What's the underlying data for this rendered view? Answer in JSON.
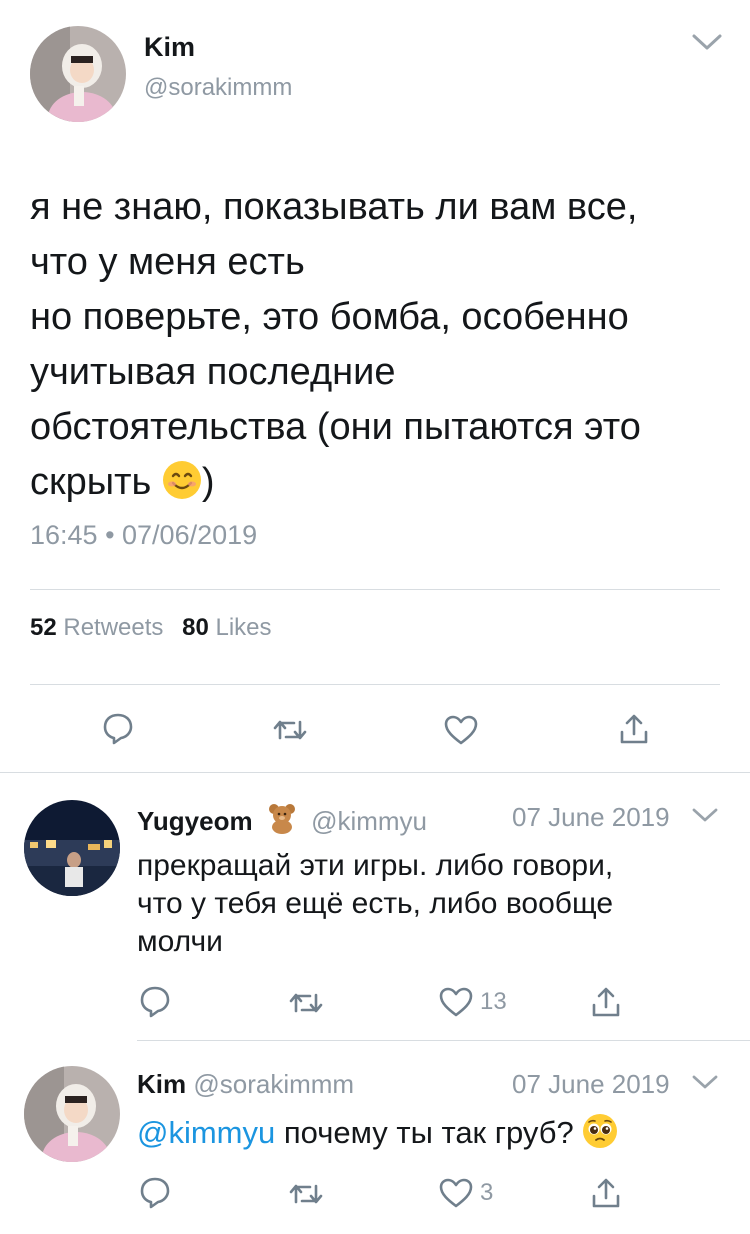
{
  "main_tweet": {
    "author_name": "Kim",
    "author_handle": "@sorakimmm",
    "text_lines": [
      "я не знаю, показывать ли вам все,",
      "что у меня есть",
      "но поверьте, это бомба, особенно",
      "учитывая последние",
      "обстоятельства (они пытаются это",
      "скрыть"
    ],
    "text_end": ")",
    "emoji": "smiling-face-emoji",
    "timestamp": "16:45 • 07/06/2019",
    "retweets_count": "52",
    "retweets_label": "Retweets",
    "likes_count": "80",
    "likes_label": "Likes"
  },
  "replies": [
    {
      "author_name": "Yugyeom",
      "author_emoji": "teddy-bear-emoji",
      "author_handle": "@kimmyu",
      "date": "07 June 2019",
      "text_lines": [
        "прекращай эти игры. либо говори,",
        "что у тебя ещё есть, либо вообще",
        "молчи"
      ],
      "reply_count": "",
      "retweet_count": "",
      "like_count": "13"
    },
    {
      "author_name": "Kim",
      "author_handle": "@sorakimmm",
      "date": "07 June 2019",
      "mention": "@kimmyu",
      "text": " почему ты так груб? ",
      "text_emoji": "pleading-face-emoji",
      "like_count": "3"
    }
  ],
  "colors": {
    "text": "#14171a",
    "secondary": "#8f99a3",
    "link": "#1b95e0",
    "divider": "#d8dde1"
  }
}
